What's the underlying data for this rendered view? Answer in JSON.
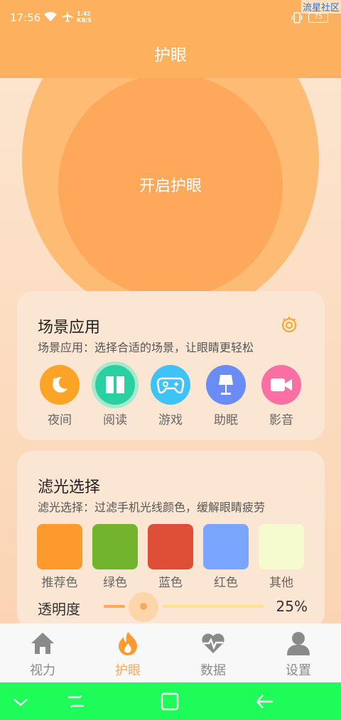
{
  "status": {
    "time": "17:56",
    "speed_value": "1.42",
    "speed_unit": "KB/S",
    "battery": "75",
    "watermark": "流星社区"
  },
  "header": {
    "title": "护眼"
  },
  "main_button": {
    "label": "开启护眼"
  },
  "scene": {
    "title": "场景应用",
    "subtitle": "场景应用：选择合适的场景，让眼睛更轻松",
    "items": [
      {
        "label": "夜间",
        "icon": "moon-stars-icon",
        "color": "#fca425"
      },
      {
        "label": "阅读",
        "icon": "open-book-icon",
        "color": "#2bd0a1"
      },
      {
        "label": "游戏",
        "icon": "gamepad-icon",
        "color": "#3fc3f6"
      },
      {
        "label": "助眠",
        "icon": "lamp-icon",
        "color": "#6a8cf4"
      },
      {
        "label": "影音",
        "icon": "video-camera-icon",
        "color": "#fb6fa5"
      }
    ]
  },
  "filter": {
    "title": "滤光选择",
    "subtitle": "滤光选择：过滤手机光线颜色，缓解眼睛疲劳",
    "items": [
      {
        "label": "推荐色",
        "color": "#fd9a2d"
      },
      {
        "label": "绿色",
        "color": "#72b42e"
      },
      {
        "label": "蓝色",
        "color": "#df4e37"
      },
      {
        "label": "红色",
        "color": "#7ba6ff"
      },
      {
        "label": "其他",
        "color": "#f5fbcf"
      }
    ],
    "opacity_label": "透明度",
    "opacity_value": "25%"
  },
  "nav": {
    "items": [
      {
        "label": "视力",
        "icon": "home-icon"
      },
      {
        "label": "护眼",
        "icon": "flame-icon"
      },
      {
        "label": "数据",
        "icon": "heart-pulse-icon"
      },
      {
        "label": "设置",
        "icon": "person-icon"
      }
    ],
    "active": "护眼"
  }
}
